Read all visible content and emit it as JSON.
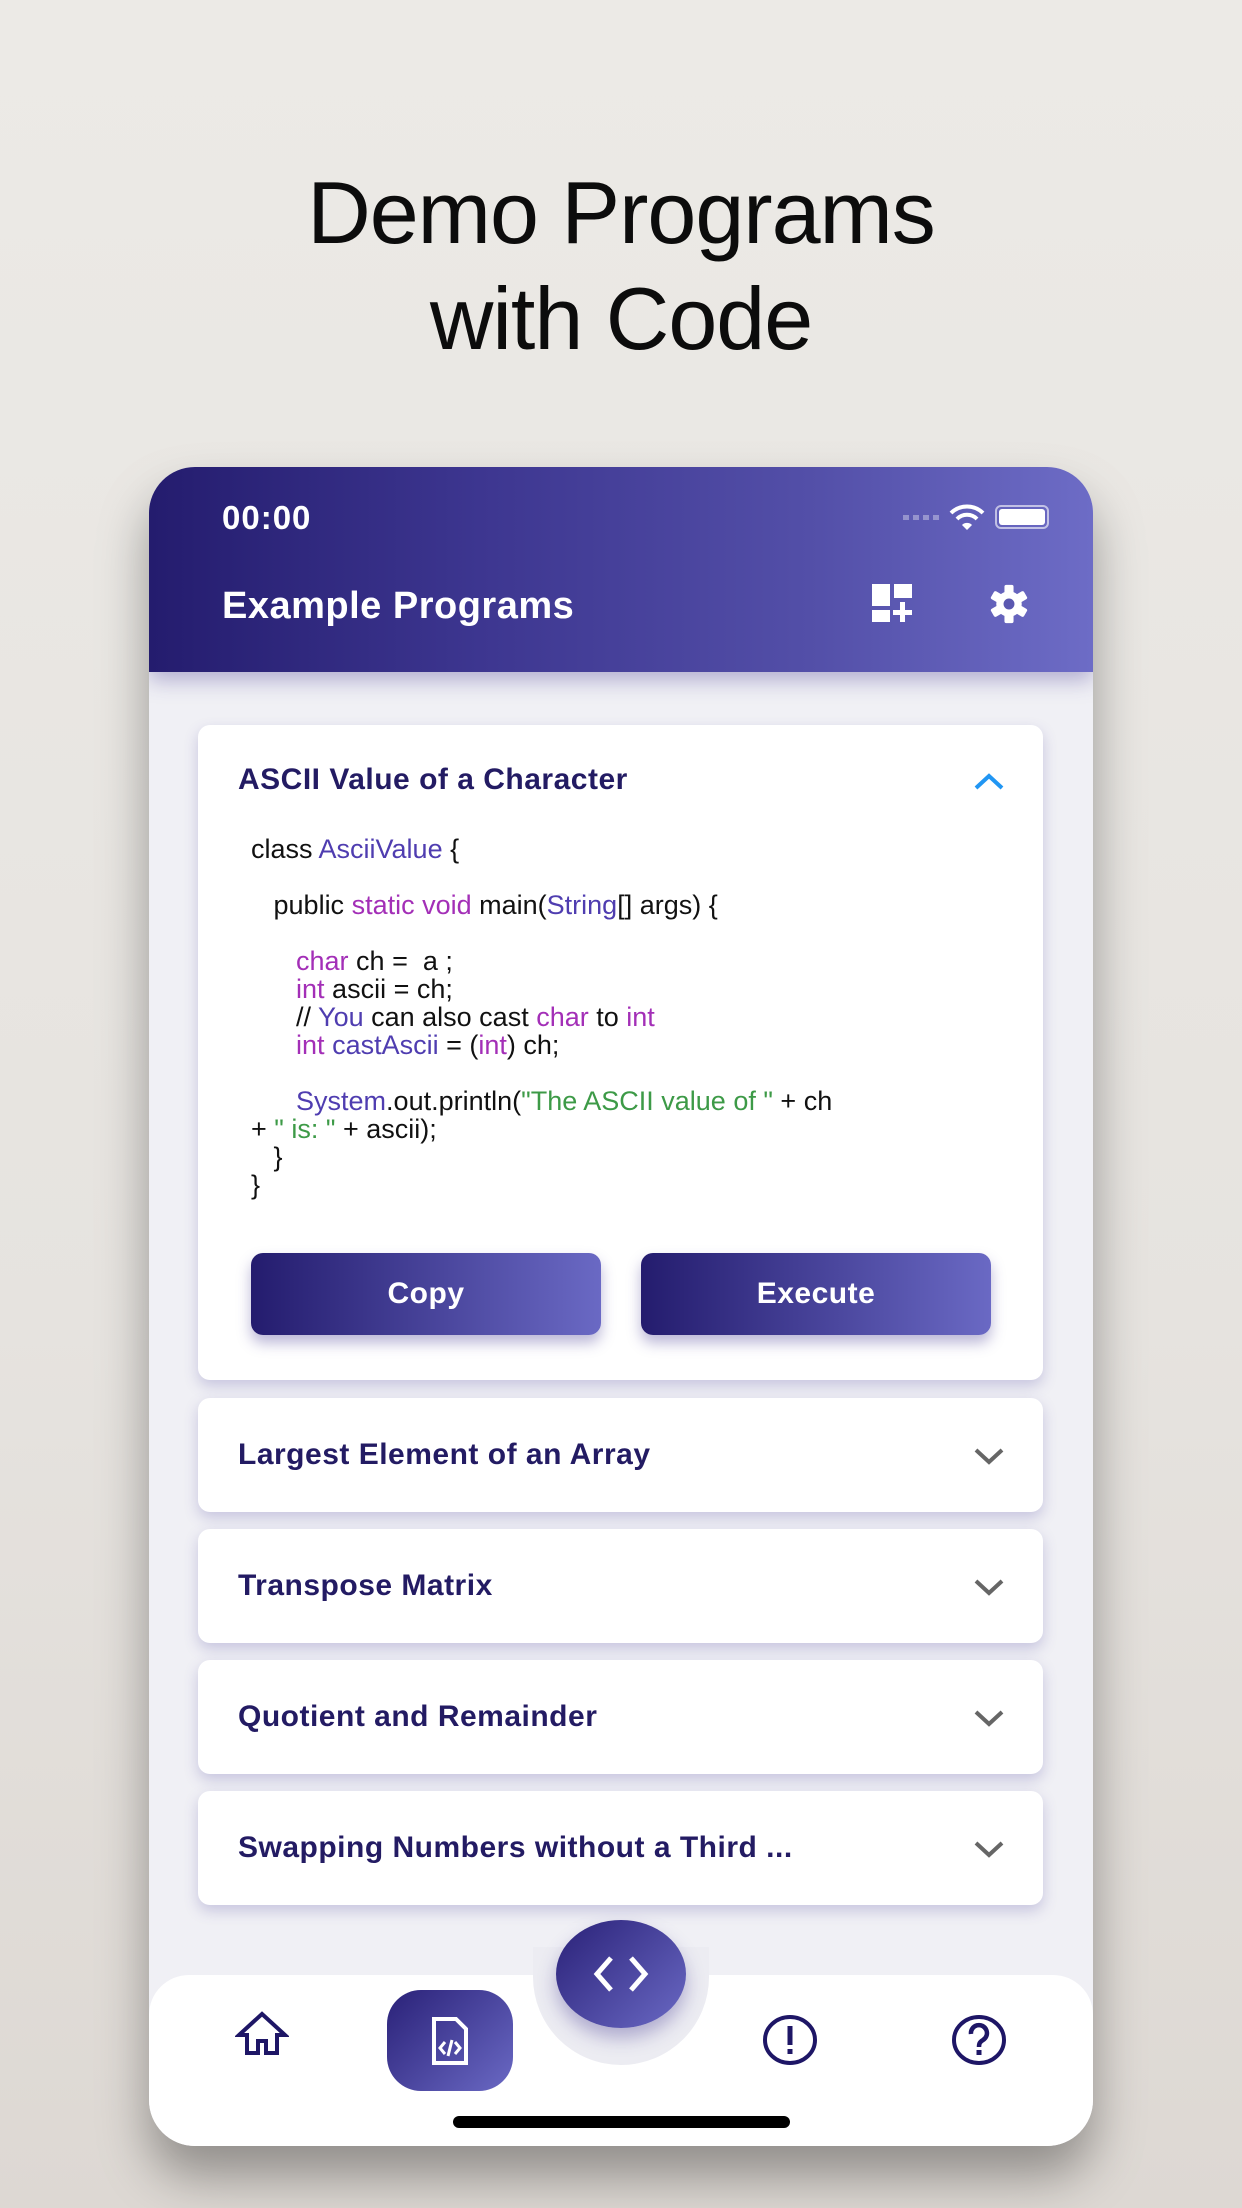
{
  "headline": {
    "line1": "Demo Programs",
    "line2": "with Code"
  },
  "status_bar": {
    "time": "00:00"
  },
  "app_bar": {
    "title": "Example Programs",
    "icons": [
      "dashboard-add-icon",
      "gear-icon"
    ]
  },
  "accent_colors": {
    "primary_dark": "#241c6e",
    "primary_light": "#6d6cc6",
    "keyword": "#a32fb7",
    "type": "#4f3db0",
    "string": "#3d9a47"
  },
  "programs": [
    {
      "title": "ASCII Value of a Character",
      "expanded": true,
      "code": [
        [
          [
            "class ",
            ""
          ],
          [
            "AsciiValue",
            "ty"
          ],
          [
            " {",
            ""
          ]
        ],
        [
          [
            "",
            ""
          ]
        ],
        [
          [
            "   public ",
            ""
          ],
          [
            "static void",
            "kw"
          ],
          [
            " main(",
            ""
          ],
          [
            "String",
            "ty"
          ],
          [
            "[] args) {",
            ""
          ]
        ],
        [
          [
            "",
            ""
          ]
        ],
        [
          [
            "      ",
            ""
          ],
          [
            "char",
            "kw"
          ],
          [
            " ch =  a ;",
            ""
          ]
        ],
        [
          [
            "      ",
            ""
          ],
          [
            "int",
            "kw"
          ],
          [
            " ascii = ch;",
            ""
          ]
        ],
        [
          [
            "      // ",
            ""
          ],
          [
            "You",
            "ty"
          ],
          [
            " can also cast ",
            ""
          ],
          [
            "char",
            "kw"
          ],
          [
            " to ",
            ""
          ],
          [
            "int",
            "kw"
          ]
        ],
        [
          [
            "      ",
            ""
          ],
          [
            "int",
            "kw"
          ],
          [
            " ",
            ""
          ],
          [
            "castAscii",
            "ty"
          ],
          [
            " = (",
            ""
          ],
          [
            "int",
            "kw"
          ],
          [
            ") ch;",
            ""
          ]
        ],
        [
          [
            "",
            ""
          ]
        ],
        [
          [
            "      ",
            ""
          ],
          [
            "System",
            "ty"
          ],
          [
            ".out.println(",
            ""
          ],
          [
            "\"The ASCII value of \"",
            "st"
          ],
          [
            " + ch",
            ""
          ]
        ],
        [
          [
            "+ ",
            ""
          ],
          [
            "\" is: \"",
            "st"
          ],
          [
            " + ascii);",
            ""
          ]
        ],
        [
          [
            "   }",
            ""
          ]
        ],
        [
          [
            "}",
            ""
          ]
        ]
      ],
      "copy_label": "Copy",
      "execute_label": "Execute"
    },
    {
      "title": "Largest Element of an Array",
      "expanded": false
    },
    {
      "title": "Transpose Matrix",
      "expanded": false
    },
    {
      "title": "Quotient and Remainder",
      "expanded": false
    },
    {
      "title": "Swapping Numbers without a Third ...",
      "expanded": false
    }
  ],
  "bottom_nav": {
    "items": [
      "home-icon",
      "code-file-icon",
      "alert-icon",
      "help-icon"
    ],
    "selected": "code-file-icon",
    "fab": "code-icon"
  }
}
